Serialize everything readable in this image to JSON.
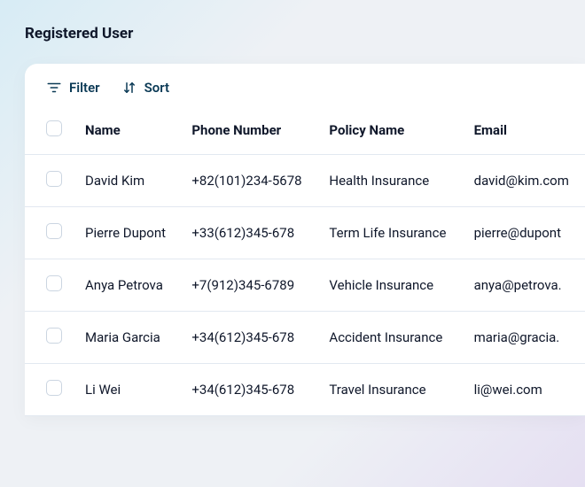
{
  "section_title": "Registered User",
  "toolbar": {
    "filter_label": "Filter",
    "sort_label": "Sort"
  },
  "columns": {
    "name": "Name",
    "phone": "Phone Number",
    "policy": "Policy Name",
    "email": "Email"
  },
  "rows": [
    {
      "name": "David Kim",
      "phone": "+82(101)234-5678",
      "policy": "Health Insurance",
      "email": "david@kim.com"
    },
    {
      "name": "Pierre Dupont",
      "phone": "+33(612)345-678",
      "policy": "Term Life Insurance",
      "email": "pierre@dupont"
    },
    {
      "name": "Anya Petrova",
      "phone": "+7(912)345-6789",
      "policy": "Vehicle Insurance",
      "email": "anya@petrova."
    },
    {
      "name": "Maria Garcia",
      "phone": "+34(612)345-678",
      "policy": "Accident Insurance",
      "email": "maria@gracia."
    },
    {
      "name": "Li Wei",
      "phone": "+34(612)345-678",
      "policy": "Travel Insurance",
      "email": "li@wei.com"
    }
  ]
}
